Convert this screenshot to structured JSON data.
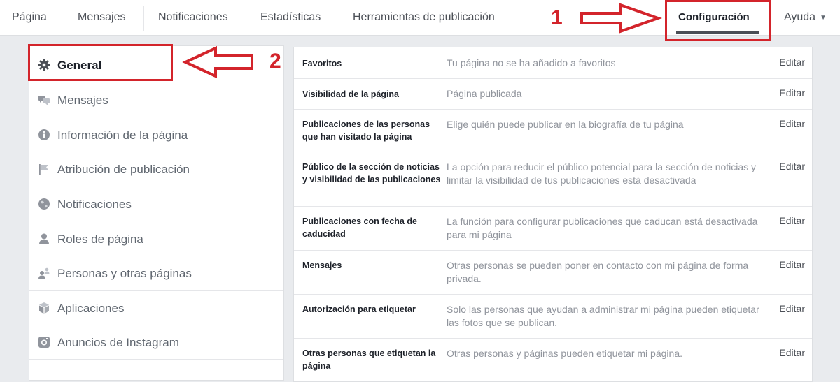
{
  "nav": {
    "items": [
      "Página",
      "Mensajes",
      "Notificaciones",
      "Estadísticas",
      "Herramientas de publicación",
      "Configuración",
      "Ayuda"
    ],
    "active": "Configuración"
  },
  "annotations": {
    "one": "1",
    "two": "2"
  },
  "sidebar": {
    "items": [
      {
        "label": "General",
        "icon": "gear-icon",
        "active": true
      },
      {
        "label": "Mensajes",
        "icon": "chat-bubbles-icon"
      },
      {
        "label": "Información de la página",
        "icon": "info-icon"
      },
      {
        "label": "Atribución de publicación",
        "icon": "flag-icon"
      },
      {
        "label": "Notificaciones",
        "icon": "globe-icon"
      },
      {
        "label": "Roles de página",
        "icon": "person-icon"
      },
      {
        "label": "Personas y otras páginas",
        "icon": "people-icon"
      },
      {
        "label": "Aplicaciones",
        "icon": "cube-icon"
      },
      {
        "label": "Anuncios de Instagram",
        "icon": "instagram-icon"
      }
    ]
  },
  "settings": {
    "edit_label": "Editar",
    "rows": [
      {
        "label": "Favoritos",
        "value": "Tu página no se ha añadido a favoritos"
      },
      {
        "label": "Visibilidad de la página",
        "value": "Página publicada"
      },
      {
        "label": "Publicaciones de las personas que han visitado la página",
        "value": "Elige quién puede publicar en la biografía de tu página"
      },
      {
        "label": "Público de la sección de noticias y visibilidad de las publicaciones",
        "value": "La opción para reducir el público potencial para la sección de noticias y limitar la visibilidad de tus publicaciones está desactivada"
      },
      {
        "label": "Publicaciones con fecha de caducidad",
        "value": "La función para configurar publicaciones que caducan está desactivada para mi página"
      },
      {
        "label": "Mensajes",
        "value": "Otras personas se pueden poner en contacto con mi página de forma privada."
      },
      {
        "label": "Autorización para etiquetar",
        "value": "Solo las personas que ayudan a administrar mi página pueden etiquetar las fotos que se publican."
      },
      {
        "label": "Otras personas que etiquetan la página",
        "value": "Otras personas y páginas pueden etiquetar mi página."
      }
    ]
  },
  "colors": {
    "annotation": "#d3242b",
    "background": "#e9ebee",
    "muted_text": "#90949c"
  }
}
